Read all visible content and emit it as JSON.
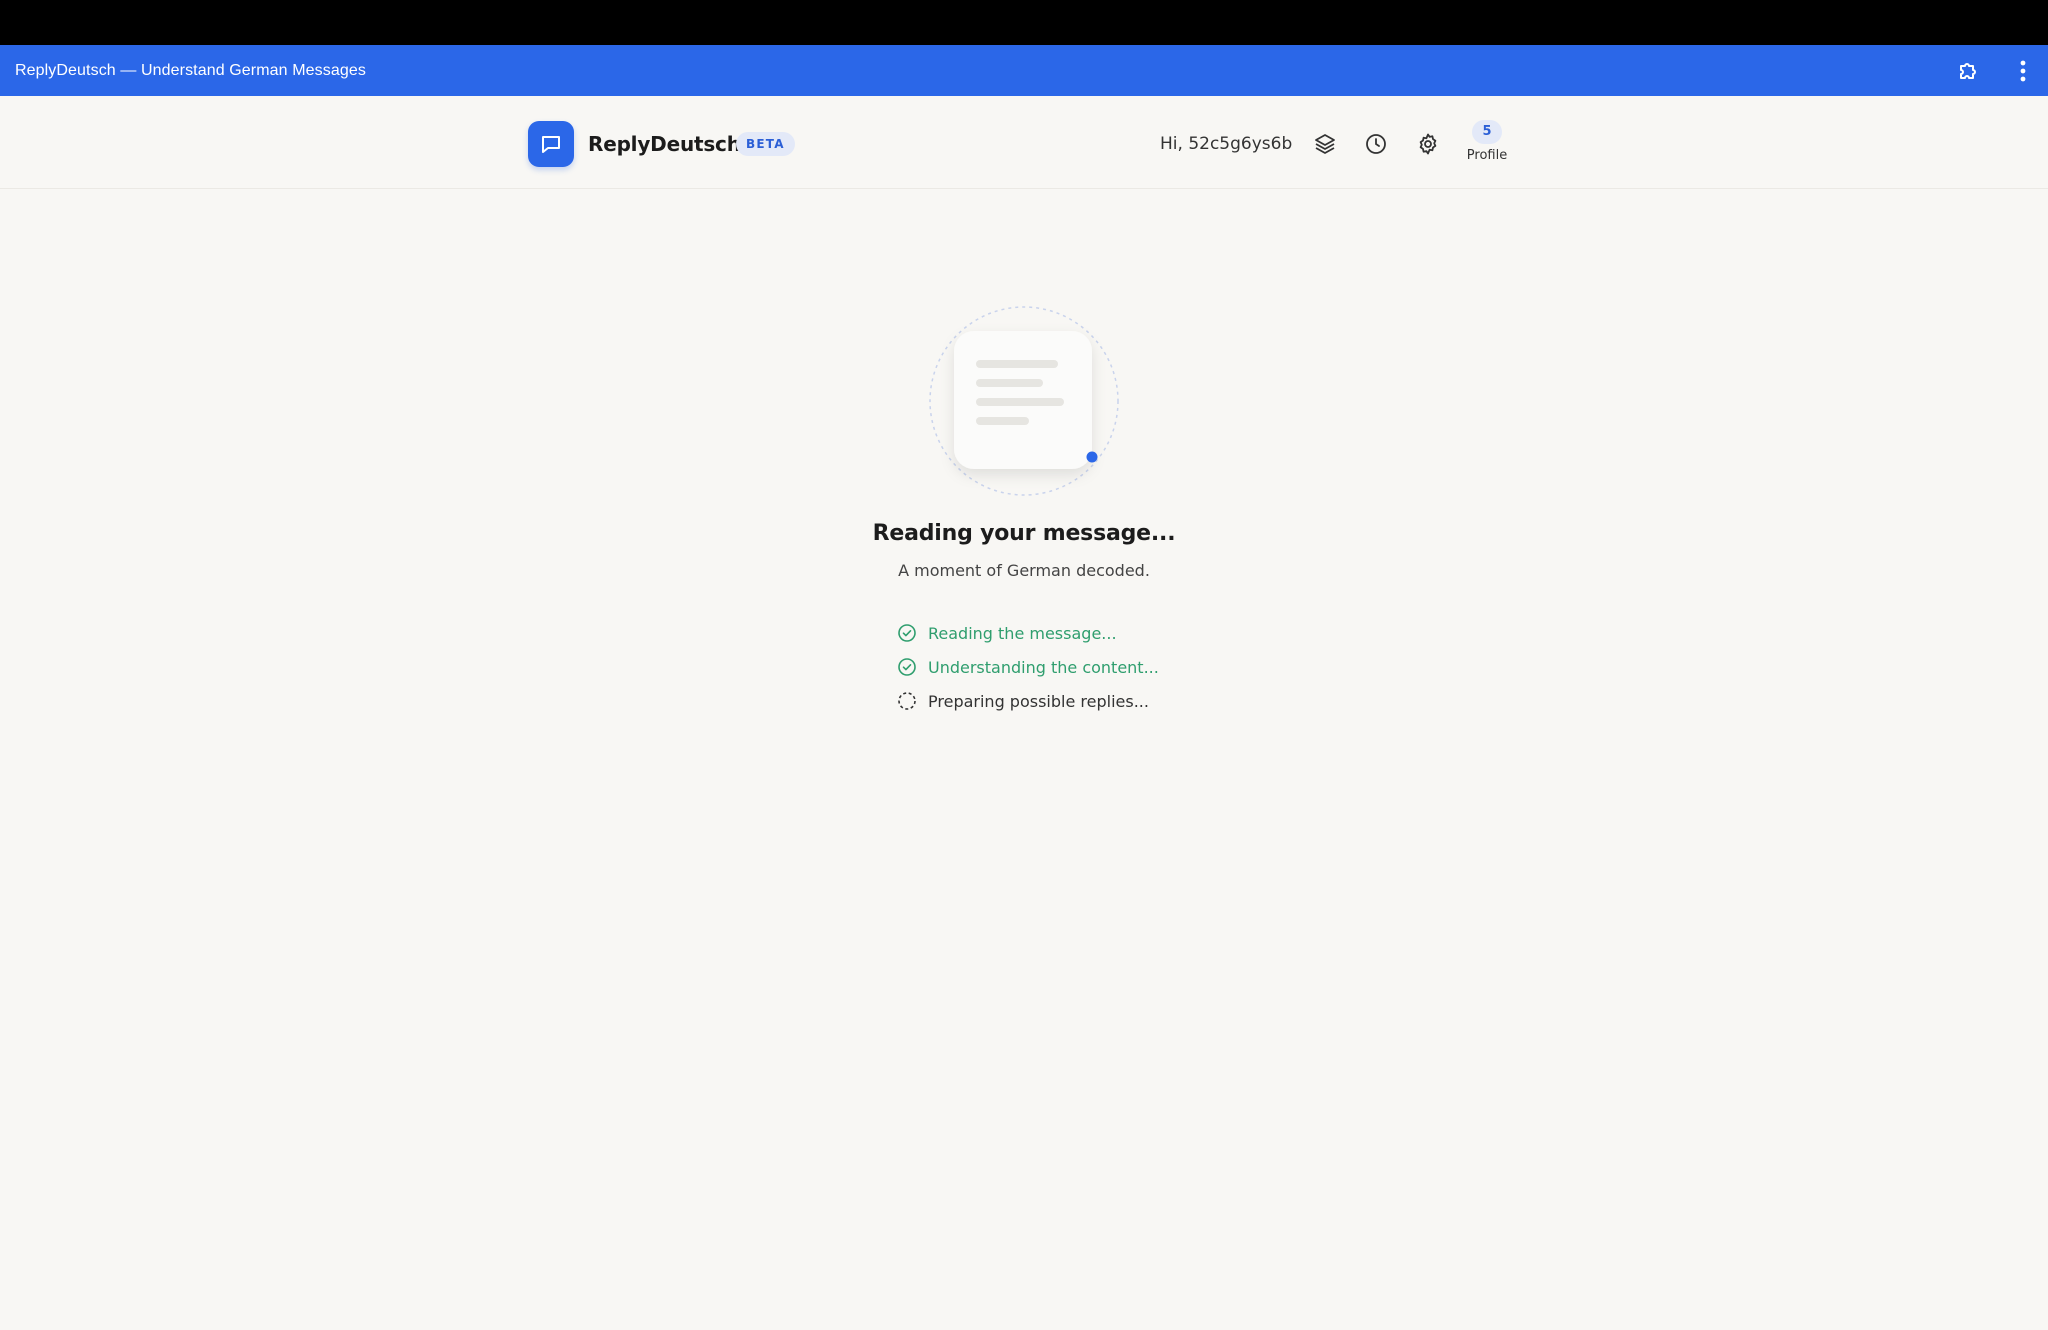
{
  "browser": {
    "title": "ReplyDeutsch — Understand German Messages",
    "extension_icon": "puzzle-icon",
    "menu_icon": "kebab-menu-icon",
    "accent": "#2b67e8"
  },
  "header": {
    "brand": "ReplyDeutsch",
    "badge": "BETA",
    "greeting": "Hi, 52c5g6ys6b",
    "icons": [
      "layers-icon",
      "history-clock-icon",
      "settings-gear-icon"
    ],
    "profile": {
      "count": "5",
      "label": "Profile"
    }
  },
  "main": {
    "headline": "Reading your message...",
    "subline": "A moment of German decoded.",
    "steps": [
      {
        "label": "Reading the message...",
        "status": "done"
      },
      {
        "label": "Understanding the content...",
        "status": "done"
      },
      {
        "label": "Preparing possible replies...",
        "status": "pending"
      }
    ]
  },
  "colors": {
    "primary": "#2b67e8",
    "success": "#2f9e6e",
    "background": "#f8f7f4"
  }
}
